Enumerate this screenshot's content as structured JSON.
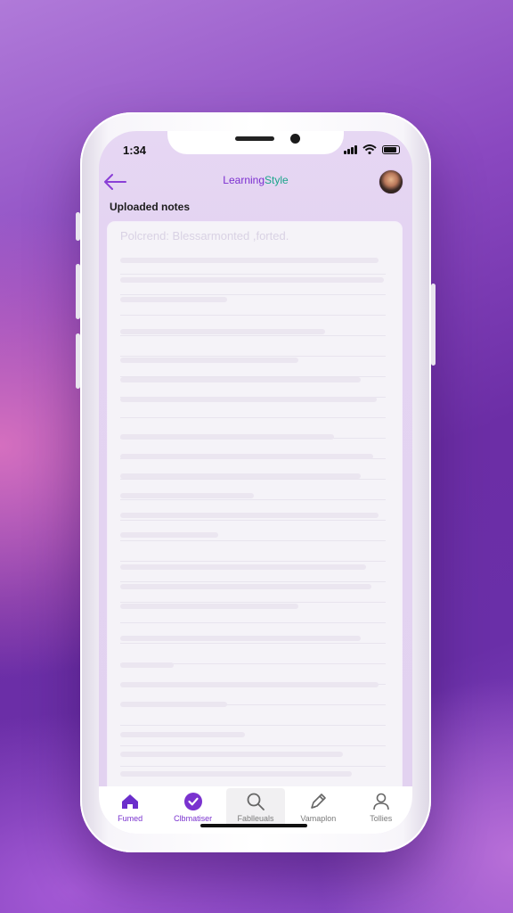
{
  "status": {
    "time": "1:34"
  },
  "header": {
    "title_part1": "Learning",
    "title_part2": "Style"
  },
  "section": {
    "title": "Uploaded notes"
  },
  "notes": {
    "heading": "Polcrend: Blessarmonted ,forted."
  },
  "tabs": [
    {
      "label": "Fumed",
      "icon": "home-icon",
      "active": true
    },
    {
      "label": "Clbmatiser",
      "icon": "notes-check-icon",
      "active": false
    },
    {
      "label": "Fablleuals",
      "icon": "search-icon",
      "active": false
    },
    {
      "label": "Vamaplon",
      "icon": "pen-icon",
      "active": false
    },
    {
      "label": "Tollies",
      "icon": "profile-icon",
      "active": false
    }
  ],
  "colors": {
    "accent": "#7a32cf",
    "brand_green": "#1aa58a",
    "header_bg": "#e4d4f2"
  }
}
